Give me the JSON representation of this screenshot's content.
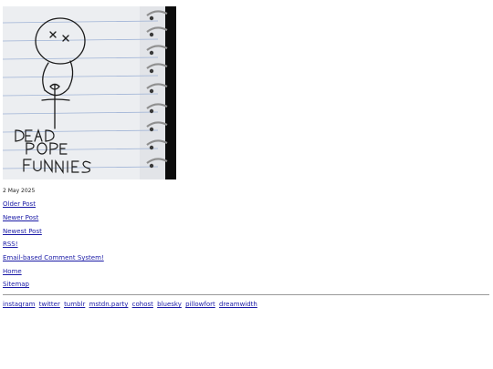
{
  "comic": {
    "alt": "DEAD POPE FUNNIES",
    "caption_lines": [
      "DEAD",
      "POPE",
      "FUNNIES"
    ]
  },
  "post": {
    "date": "2 May 2025"
  },
  "nav": {
    "older": "Older Post",
    "newer": "Newer Post",
    "newest": "Newest Post",
    "rss": "RSS!",
    "email": "Email-based Comment System!",
    "home": "Home",
    "sitemap": "Sitemap"
  },
  "footer": {
    "links": [
      "instagram",
      "twitter",
      "tumblr",
      "mstdn.party",
      "cohost",
      "bluesky",
      "pillowfort",
      "dreamwidth"
    ]
  },
  "colors": {
    "link": "#1a1aa6",
    "paper": "#eef0f2",
    "rule_lines": "#9fb3d6",
    "ink": "#1a1a1a",
    "notebook_edge": "#0c0c0c"
  }
}
